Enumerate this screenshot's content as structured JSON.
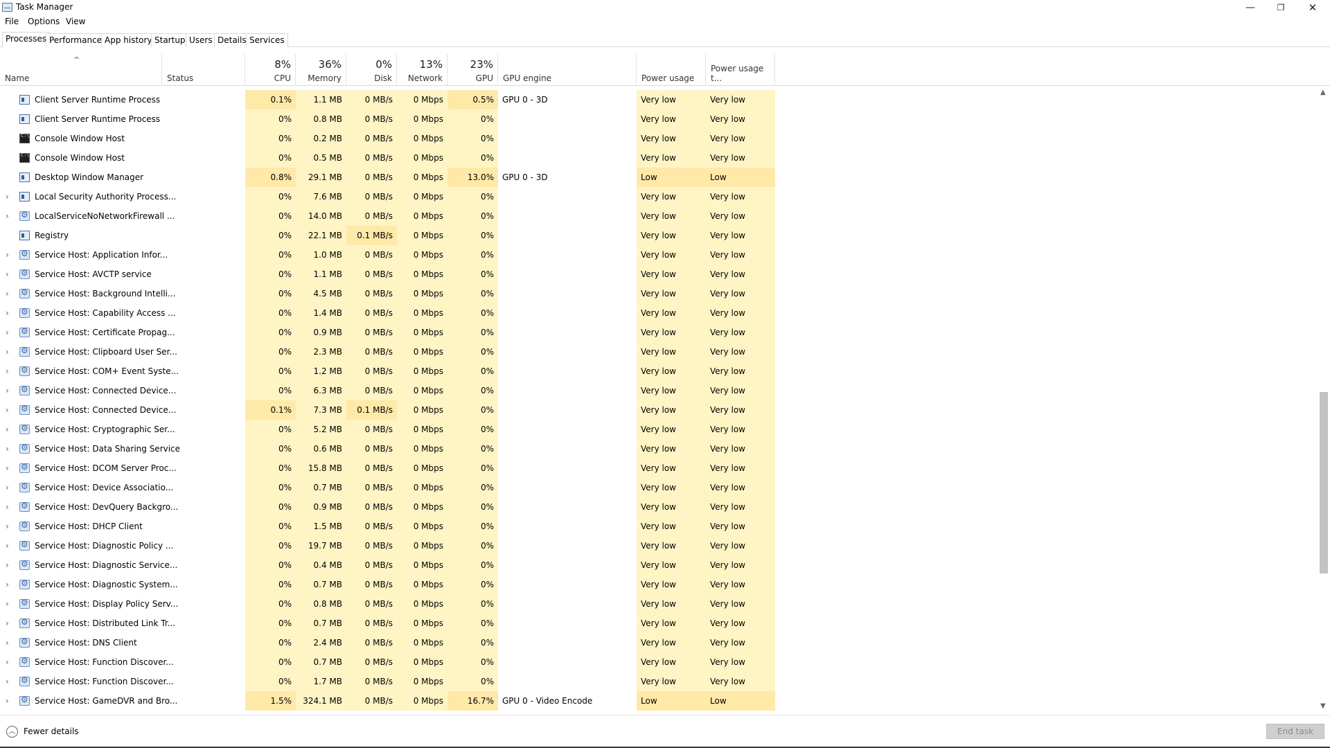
{
  "window": {
    "title": "Task Manager",
    "min_glyph": "—",
    "max_glyph": "❐",
    "close_glyph": "✕"
  },
  "menu": [
    "File",
    "Options",
    "View"
  ],
  "tabs": [
    {
      "label": "Processes",
      "active": true
    },
    {
      "label": "Performance",
      "active": false
    },
    {
      "label": "App history",
      "active": false
    },
    {
      "label": "Startup",
      "active": false
    },
    {
      "label": "Users",
      "active": false
    },
    {
      "label": "Details",
      "active": false
    },
    {
      "label": "Services",
      "active": false
    }
  ],
  "columns": {
    "sort_glyph": "^",
    "name": "Name",
    "status": "Status",
    "cpu": {
      "percent": "8%",
      "label": "CPU"
    },
    "memory": {
      "percent": "36%",
      "label": "Memory"
    },
    "disk": {
      "percent": "0%",
      "label": "Disk"
    },
    "network": {
      "percent": "13%",
      "label": "Network"
    },
    "gpu": {
      "percent": "23%",
      "label": "GPU"
    },
    "gpu_engine": "GPU engine",
    "power": "Power usage",
    "power_trend": "Power usage t..."
  },
  "colors": {
    "heat_low": "#fff4c4",
    "heat_mid": "#ffe9a8",
    "header_border": "#d9d9d9"
  },
  "rows": [
    {
      "expand": false,
      "icon": "window",
      "name": "Client Server Runtime Process",
      "status": "",
      "cpu": "0.1%",
      "memory": "1.1 MB",
      "disk": "0 MB/s",
      "network": "0 Mbps",
      "gpu": "0.5%",
      "gpu_engine": "GPU 0 - 3D",
      "power": "Very low",
      "power_trend": "Very low"
    },
    {
      "expand": false,
      "icon": "window",
      "name": "Client Server Runtime Process",
      "status": "",
      "cpu": "0%",
      "memory": "0.8 MB",
      "disk": "0 MB/s",
      "network": "0 Mbps",
      "gpu": "0%",
      "gpu_engine": "",
      "power": "Very low",
      "power_trend": "Very low"
    },
    {
      "expand": false,
      "icon": "console",
      "name": "Console Window Host",
      "status": "",
      "cpu": "0%",
      "memory": "0.2 MB",
      "disk": "0 MB/s",
      "network": "0 Mbps",
      "gpu": "0%",
      "gpu_engine": "",
      "power": "Very low",
      "power_trend": "Very low"
    },
    {
      "expand": false,
      "icon": "console",
      "name": "Console Window Host",
      "status": "",
      "cpu": "0%",
      "memory": "0.5 MB",
      "disk": "0 MB/s",
      "network": "0 Mbps",
      "gpu": "0%",
      "gpu_engine": "",
      "power": "Very low",
      "power_trend": "Very low"
    },
    {
      "expand": false,
      "icon": "window",
      "name": "Desktop Window Manager",
      "status": "",
      "cpu": "0.8%",
      "memory": "29.1 MB",
      "disk": "0 MB/s",
      "network": "0 Mbps",
      "gpu": "13.0%",
      "gpu_engine": "GPU 0 - 3D",
      "power": "Low",
      "power_trend": "Low"
    },
    {
      "expand": true,
      "icon": "window",
      "name": "Local Security Authority Process...",
      "status": "",
      "cpu": "0%",
      "memory": "7.6 MB",
      "disk": "0 MB/s",
      "network": "0 Mbps",
      "gpu": "0%",
      "gpu_engine": "",
      "power": "Very low",
      "power_trend": "Very low"
    },
    {
      "expand": true,
      "icon": "gear",
      "name": "LocalServiceNoNetworkFirewall ...",
      "status": "",
      "cpu": "0%",
      "memory": "14.0 MB",
      "disk": "0 MB/s",
      "network": "0 Mbps",
      "gpu": "0%",
      "gpu_engine": "",
      "power": "Very low",
      "power_trend": "Very low"
    },
    {
      "expand": false,
      "icon": "window",
      "name": "Registry",
      "status": "",
      "cpu": "0%",
      "memory": "22.1 MB",
      "disk": "0.1 MB/s",
      "network": "0 Mbps",
      "gpu": "0%",
      "gpu_engine": "",
      "power": "Very low",
      "power_trend": "Very low"
    },
    {
      "expand": true,
      "icon": "gear",
      "name": "Service Host: Application Infor...",
      "status": "",
      "cpu": "0%",
      "memory": "1.0 MB",
      "disk": "0 MB/s",
      "network": "0 Mbps",
      "gpu": "0%",
      "gpu_engine": "",
      "power": "Very low",
      "power_trend": "Very low"
    },
    {
      "expand": true,
      "icon": "gear",
      "name": "Service Host: AVCTP service",
      "status": "",
      "cpu": "0%",
      "memory": "1.1 MB",
      "disk": "0 MB/s",
      "network": "0 Mbps",
      "gpu": "0%",
      "gpu_engine": "",
      "power": "Very low",
      "power_trend": "Very low"
    },
    {
      "expand": true,
      "icon": "gear",
      "name": "Service Host: Background Intelli...",
      "status": "",
      "cpu": "0%",
      "memory": "4.5 MB",
      "disk": "0 MB/s",
      "network": "0 Mbps",
      "gpu": "0%",
      "gpu_engine": "",
      "power": "Very low",
      "power_trend": "Very low"
    },
    {
      "expand": true,
      "icon": "gear",
      "name": "Service Host: Capability Access ...",
      "status": "",
      "cpu": "0%",
      "memory": "1.4 MB",
      "disk": "0 MB/s",
      "network": "0 Mbps",
      "gpu": "0%",
      "gpu_engine": "",
      "power": "Very low",
      "power_trend": "Very low"
    },
    {
      "expand": true,
      "icon": "gear",
      "name": "Service Host: Certificate Propag...",
      "status": "",
      "cpu": "0%",
      "memory": "0.9 MB",
      "disk": "0 MB/s",
      "network": "0 Mbps",
      "gpu": "0%",
      "gpu_engine": "",
      "power": "Very low",
      "power_trend": "Very low"
    },
    {
      "expand": true,
      "icon": "gear",
      "name": "Service Host: Clipboard User Ser...",
      "status": "",
      "cpu": "0%",
      "memory": "2.3 MB",
      "disk": "0 MB/s",
      "network": "0 Mbps",
      "gpu": "0%",
      "gpu_engine": "",
      "power": "Very low",
      "power_trend": "Very low"
    },
    {
      "expand": true,
      "icon": "gear",
      "name": "Service Host: COM+ Event Syste...",
      "status": "",
      "cpu": "0%",
      "memory": "1.2 MB",
      "disk": "0 MB/s",
      "network": "0 Mbps",
      "gpu": "0%",
      "gpu_engine": "",
      "power": "Very low",
      "power_trend": "Very low"
    },
    {
      "expand": true,
      "icon": "gear",
      "name": "Service Host: Connected Device...",
      "status": "",
      "cpu": "0%",
      "memory": "6.3 MB",
      "disk": "0 MB/s",
      "network": "0 Mbps",
      "gpu": "0%",
      "gpu_engine": "",
      "power": "Very low",
      "power_trend": "Very low"
    },
    {
      "expand": true,
      "icon": "gear",
      "name": "Service Host: Connected Device...",
      "status": "",
      "cpu": "0.1%",
      "memory": "7.3 MB",
      "disk": "0.1 MB/s",
      "network": "0 Mbps",
      "gpu": "0%",
      "gpu_engine": "",
      "power": "Very low",
      "power_trend": "Very low"
    },
    {
      "expand": true,
      "icon": "gear",
      "name": "Service Host: Cryptographic Ser...",
      "status": "",
      "cpu": "0%",
      "memory": "5.2 MB",
      "disk": "0 MB/s",
      "network": "0 Mbps",
      "gpu": "0%",
      "gpu_engine": "",
      "power": "Very low",
      "power_trend": "Very low"
    },
    {
      "expand": true,
      "icon": "gear",
      "name": "Service Host: Data Sharing Service",
      "status": "",
      "cpu": "0%",
      "memory": "0.6 MB",
      "disk": "0 MB/s",
      "network": "0 Mbps",
      "gpu": "0%",
      "gpu_engine": "",
      "power": "Very low",
      "power_trend": "Very low"
    },
    {
      "expand": true,
      "icon": "gear",
      "name": "Service Host: DCOM Server Proc...",
      "status": "",
      "cpu": "0%",
      "memory": "15.8 MB",
      "disk": "0 MB/s",
      "network": "0 Mbps",
      "gpu": "0%",
      "gpu_engine": "",
      "power": "Very low",
      "power_trend": "Very low"
    },
    {
      "expand": true,
      "icon": "gear",
      "name": "Service Host: Device Associatio...",
      "status": "",
      "cpu": "0%",
      "memory": "0.7 MB",
      "disk": "0 MB/s",
      "network": "0 Mbps",
      "gpu": "0%",
      "gpu_engine": "",
      "power": "Very low",
      "power_trend": "Very low"
    },
    {
      "expand": true,
      "icon": "gear",
      "name": "Service Host: DevQuery Backgro...",
      "status": "",
      "cpu": "0%",
      "memory": "0.9 MB",
      "disk": "0 MB/s",
      "network": "0 Mbps",
      "gpu": "0%",
      "gpu_engine": "",
      "power": "Very low",
      "power_trend": "Very low"
    },
    {
      "expand": true,
      "icon": "gear",
      "name": "Service Host: DHCP Client",
      "status": "",
      "cpu": "0%",
      "memory": "1.5 MB",
      "disk": "0 MB/s",
      "network": "0 Mbps",
      "gpu": "0%",
      "gpu_engine": "",
      "power": "Very low",
      "power_trend": "Very low"
    },
    {
      "expand": true,
      "icon": "gear",
      "name": "Service Host: Diagnostic Policy ...",
      "status": "",
      "cpu": "0%",
      "memory": "19.7 MB",
      "disk": "0 MB/s",
      "network": "0 Mbps",
      "gpu": "0%",
      "gpu_engine": "",
      "power": "Very low",
      "power_trend": "Very low"
    },
    {
      "expand": true,
      "icon": "gear",
      "name": "Service Host: Diagnostic Service...",
      "status": "",
      "cpu": "0%",
      "memory": "0.4 MB",
      "disk": "0 MB/s",
      "network": "0 Mbps",
      "gpu": "0%",
      "gpu_engine": "",
      "power": "Very low",
      "power_trend": "Very low"
    },
    {
      "expand": true,
      "icon": "gear",
      "name": "Service Host: Diagnostic System...",
      "status": "",
      "cpu": "0%",
      "memory": "0.7 MB",
      "disk": "0 MB/s",
      "network": "0 Mbps",
      "gpu": "0%",
      "gpu_engine": "",
      "power": "Very low",
      "power_trend": "Very low"
    },
    {
      "expand": true,
      "icon": "gear",
      "name": "Service Host: Display Policy Serv...",
      "status": "",
      "cpu": "0%",
      "memory": "0.8 MB",
      "disk": "0 MB/s",
      "network": "0 Mbps",
      "gpu": "0%",
      "gpu_engine": "",
      "power": "Very low",
      "power_trend": "Very low"
    },
    {
      "expand": true,
      "icon": "gear",
      "name": "Service Host: Distributed Link Tr...",
      "status": "",
      "cpu": "0%",
      "memory": "0.7 MB",
      "disk": "0 MB/s",
      "network": "0 Mbps",
      "gpu": "0%",
      "gpu_engine": "",
      "power": "Very low",
      "power_trend": "Very low"
    },
    {
      "expand": true,
      "icon": "gear",
      "name": "Service Host: DNS Client",
      "status": "",
      "cpu": "0%",
      "memory": "2.4 MB",
      "disk": "0 MB/s",
      "network": "0 Mbps",
      "gpu": "0%",
      "gpu_engine": "",
      "power": "Very low",
      "power_trend": "Very low"
    },
    {
      "expand": true,
      "icon": "gear",
      "name": "Service Host: Function Discover...",
      "status": "",
      "cpu": "0%",
      "memory": "0.7 MB",
      "disk": "0 MB/s",
      "network": "0 Mbps",
      "gpu": "0%",
      "gpu_engine": "",
      "power": "Very low",
      "power_trend": "Very low"
    },
    {
      "expand": true,
      "icon": "gear",
      "name": "Service Host: Function Discover...",
      "status": "",
      "cpu": "0%",
      "memory": "1.7 MB",
      "disk": "0 MB/s",
      "network": "0 Mbps",
      "gpu": "0%",
      "gpu_engine": "",
      "power": "Very low",
      "power_trend": "Very low"
    },
    {
      "expand": true,
      "icon": "gear",
      "name": "Service Host: GameDVR and Bro...",
      "status": "",
      "cpu": "1.5%",
      "memory": "324.1 MB",
      "disk": "0 MB/s",
      "network": "0 Mbps",
      "gpu": "16.7%",
      "gpu_engine": "GPU 0 - Video Encode",
      "power": "Low",
      "power_trend": "Low"
    }
  ],
  "footer": {
    "fewer_glyph": "︿",
    "fewer_label": "Fewer details",
    "end_task": "End task"
  },
  "scroll": {
    "up_glyph": "▲",
    "down_glyph": "▼"
  }
}
